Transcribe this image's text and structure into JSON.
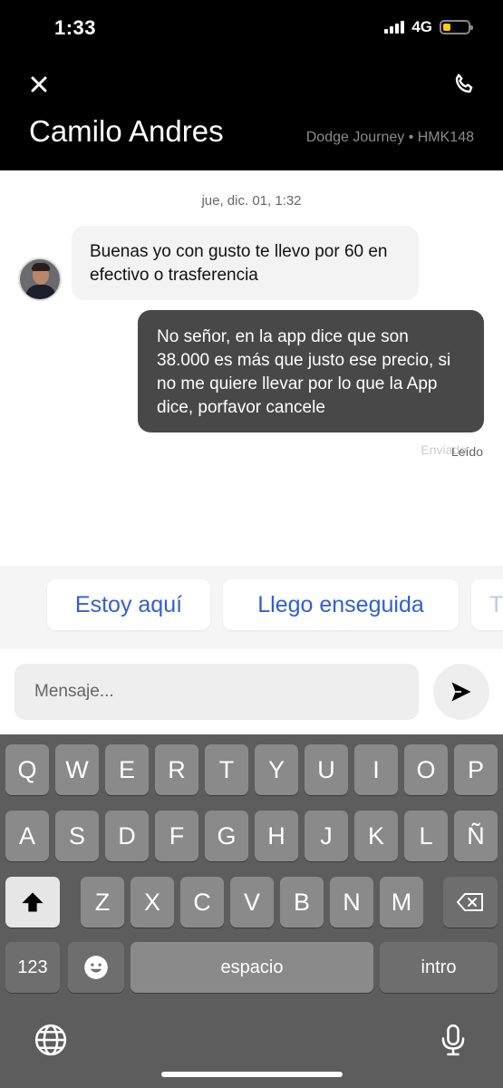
{
  "status_bar": {
    "time": "1:33",
    "network": "4G"
  },
  "header": {
    "contact_name": "Camilo Andres",
    "vehicle": "Dodge Journey • HMK148",
    "close_icon": "close-icon",
    "phone_icon": "phone-icon"
  },
  "chat": {
    "date": "jue, dic. 01, 1:32",
    "messages": [
      {
        "direction": "incoming",
        "text": "Buenas yo con gusto te llevo por 60 en efectivo o trasferencia"
      },
      {
        "direction": "outgoing",
        "text": "No señor, en la app dice que son 38.000 es más que justo ese precio, si no me quiere llevar por lo que la App dice, porfavor cancele"
      }
    ],
    "status_ghost": "Enviado",
    "status": "Leído"
  },
  "quick_replies": [
    "Estoy aquí",
    "Llego enseguida",
    "T"
  ],
  "composer": {
    "placeholder": "Mensaje...",
    "send_icon": "send-icon"
  },
  "keyboard": {
    "row1": [
      "Q",
      "W",
      "E",
      "R",
      "T",
      "Y",
      "U",
      "I",
      "O",
      "P"
    ],
    "row2": [
      "A",
      "S",
      "D",
      "F",
      "G",
      "H",
      "J",
      "K",
      "L",
      "Ñ"
    ],
    "row3": [
      "Z",
      "X",
      "C",
      "V",
      "B",
      "N",
      "M"
    ],
    "numbers": "123",
    "space": "espacio",
    "return": "intro"
  },
  "colors": {
    "accent": "#2f5fd6",
    "outgoing_bubble": "#484848",
    "header_bg": "#000000",
    "battery": "#ffcc00"
  }
}
